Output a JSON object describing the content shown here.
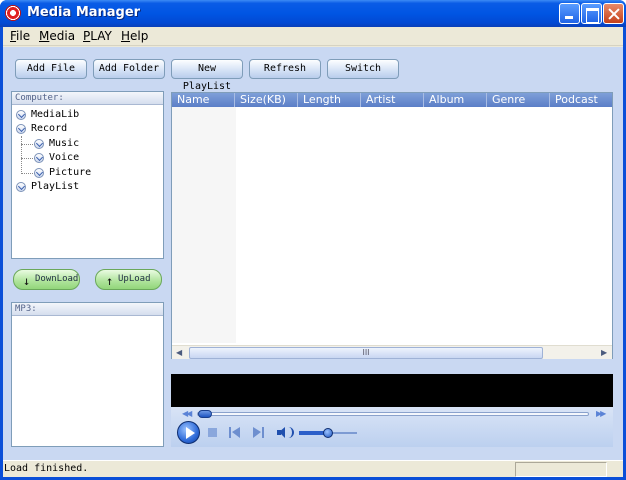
{
  "window": {
    "title": "Media Manager"
  },
  "menu": [
    {
      "pre": "",
      "ul": "F",
      "post": "ile"
    },
    {
      "pre": "",
      "ul": "M",
      "post": "edia"
    },
    {
      "pre": "",
      "ul": "P",
      "post": "LAY"
    },
    {
      "pre": "",
      "ul": "H",
      "post": "elp"
    }
  ],
  "toolbar": {
    "add_file": "Add File",
    "add_folder": "Add Folder",
    "new_playlist": "New PlayList",
    "refresh": "Refresh",
    "switch": "Switch"
  },
  "computer_panel": {
    "header": "Computer:",
    "tree": [
      {
        "label": "MediaLib",
        "level": 0
      },
      {
        "label": "Record",
        "level": 0
      },
      {
        "label": "Music",
        "level": 1
      },
      {
        "label": "Voice",
        "level": 1
      },
      {
        "label": "Picture",
        "level": 1
      },
      {
        "label": "PlayList",
        "level": 0
      }
    ]
  },
  "transfer": {
    "download": "DownLoad",
    "upload": "UpLoad",
    "download_icon": "arrow-down-icon",
    "upload_icon": "arrow-up-icon"
  },
  "mp3_panel": {
    "header": "MP3:"
  },
  "list": {
    "columns": [
      "Name",
      "Size(KB)",
      "Length",
      "Artist",
      "Album",
      "Genre",
      "Podcast"
    ],
    "scroll_grip": "III"
  },
  "player": {
    "volume_level": 0.5,
    "seek_position": 0.0
  },
  "status": {
    "text": "Load finished."
  },
  "colors": {
    "title_bar": "#0055e3",
    "list_header": "#6b8fd0",
    "green_button": "#aee39a"
  }
}
